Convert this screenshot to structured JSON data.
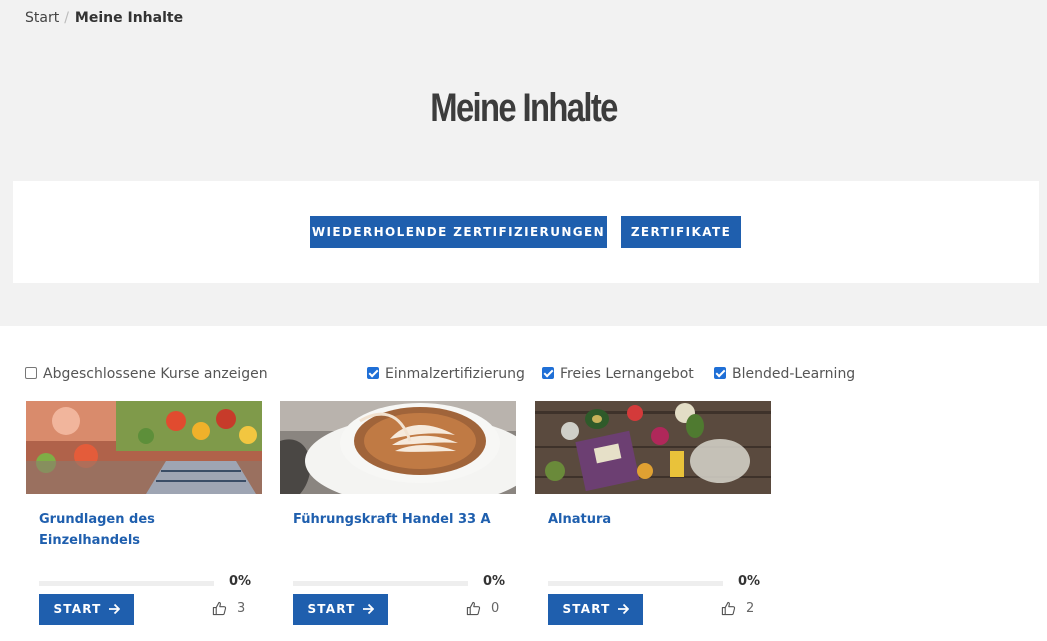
{
  "breadcrumb": {
    "home": "Start",
    "current": "Meine Inhalte"
  },
  "page": {
    "title": "Meine Inhalte"
  },
  "actions": {
    "recurring": "WIEDERHOLENDE ZERTIFIZIERUNGEN",
    "certificates": "ZERTIFIKATE"
  },
  "filters": {
    "show_completed": {
      "label": "Abgeschlossene Kurse anzeigen",
      "checked": false
    },
    "single": {
      "label": "Einmalzertifizierung",
      "checked": true
    },
    "free": {
      "label": "Freies Lernangebot",
      "checked": true
    },
    "blended": {
      "label": "Blended-Learning",
      "checked": true
    }
  },
  "courses": [
    {
      "title": "Grundlagen des Einzelhandels",
      "progress_label": "0%",
      "progress": 0,
      "start_label": "START",
      "likes": "3"
    },
    {
      "title": "Führungskraft Handel 33 A",
      "progress_label": "0%",
      "progress": 0,
      "start_label": "START",
      "likes": "0"
    },
    {
      "title": "Alnatura",
      "progress_label": "0%",
      "progress": 0,
      "start_label": "START",
      "likes": "2"
    }
  ],
  "colors": {
    "primary": "#1f5fae",
    "header_bg": "#f2f2f2",
    "checkbox": "#1f6fd6"
  },
  "icons": {
    "start": "arrow-right-icon",
    "like": "thumbs-up-icon"
  }
}
